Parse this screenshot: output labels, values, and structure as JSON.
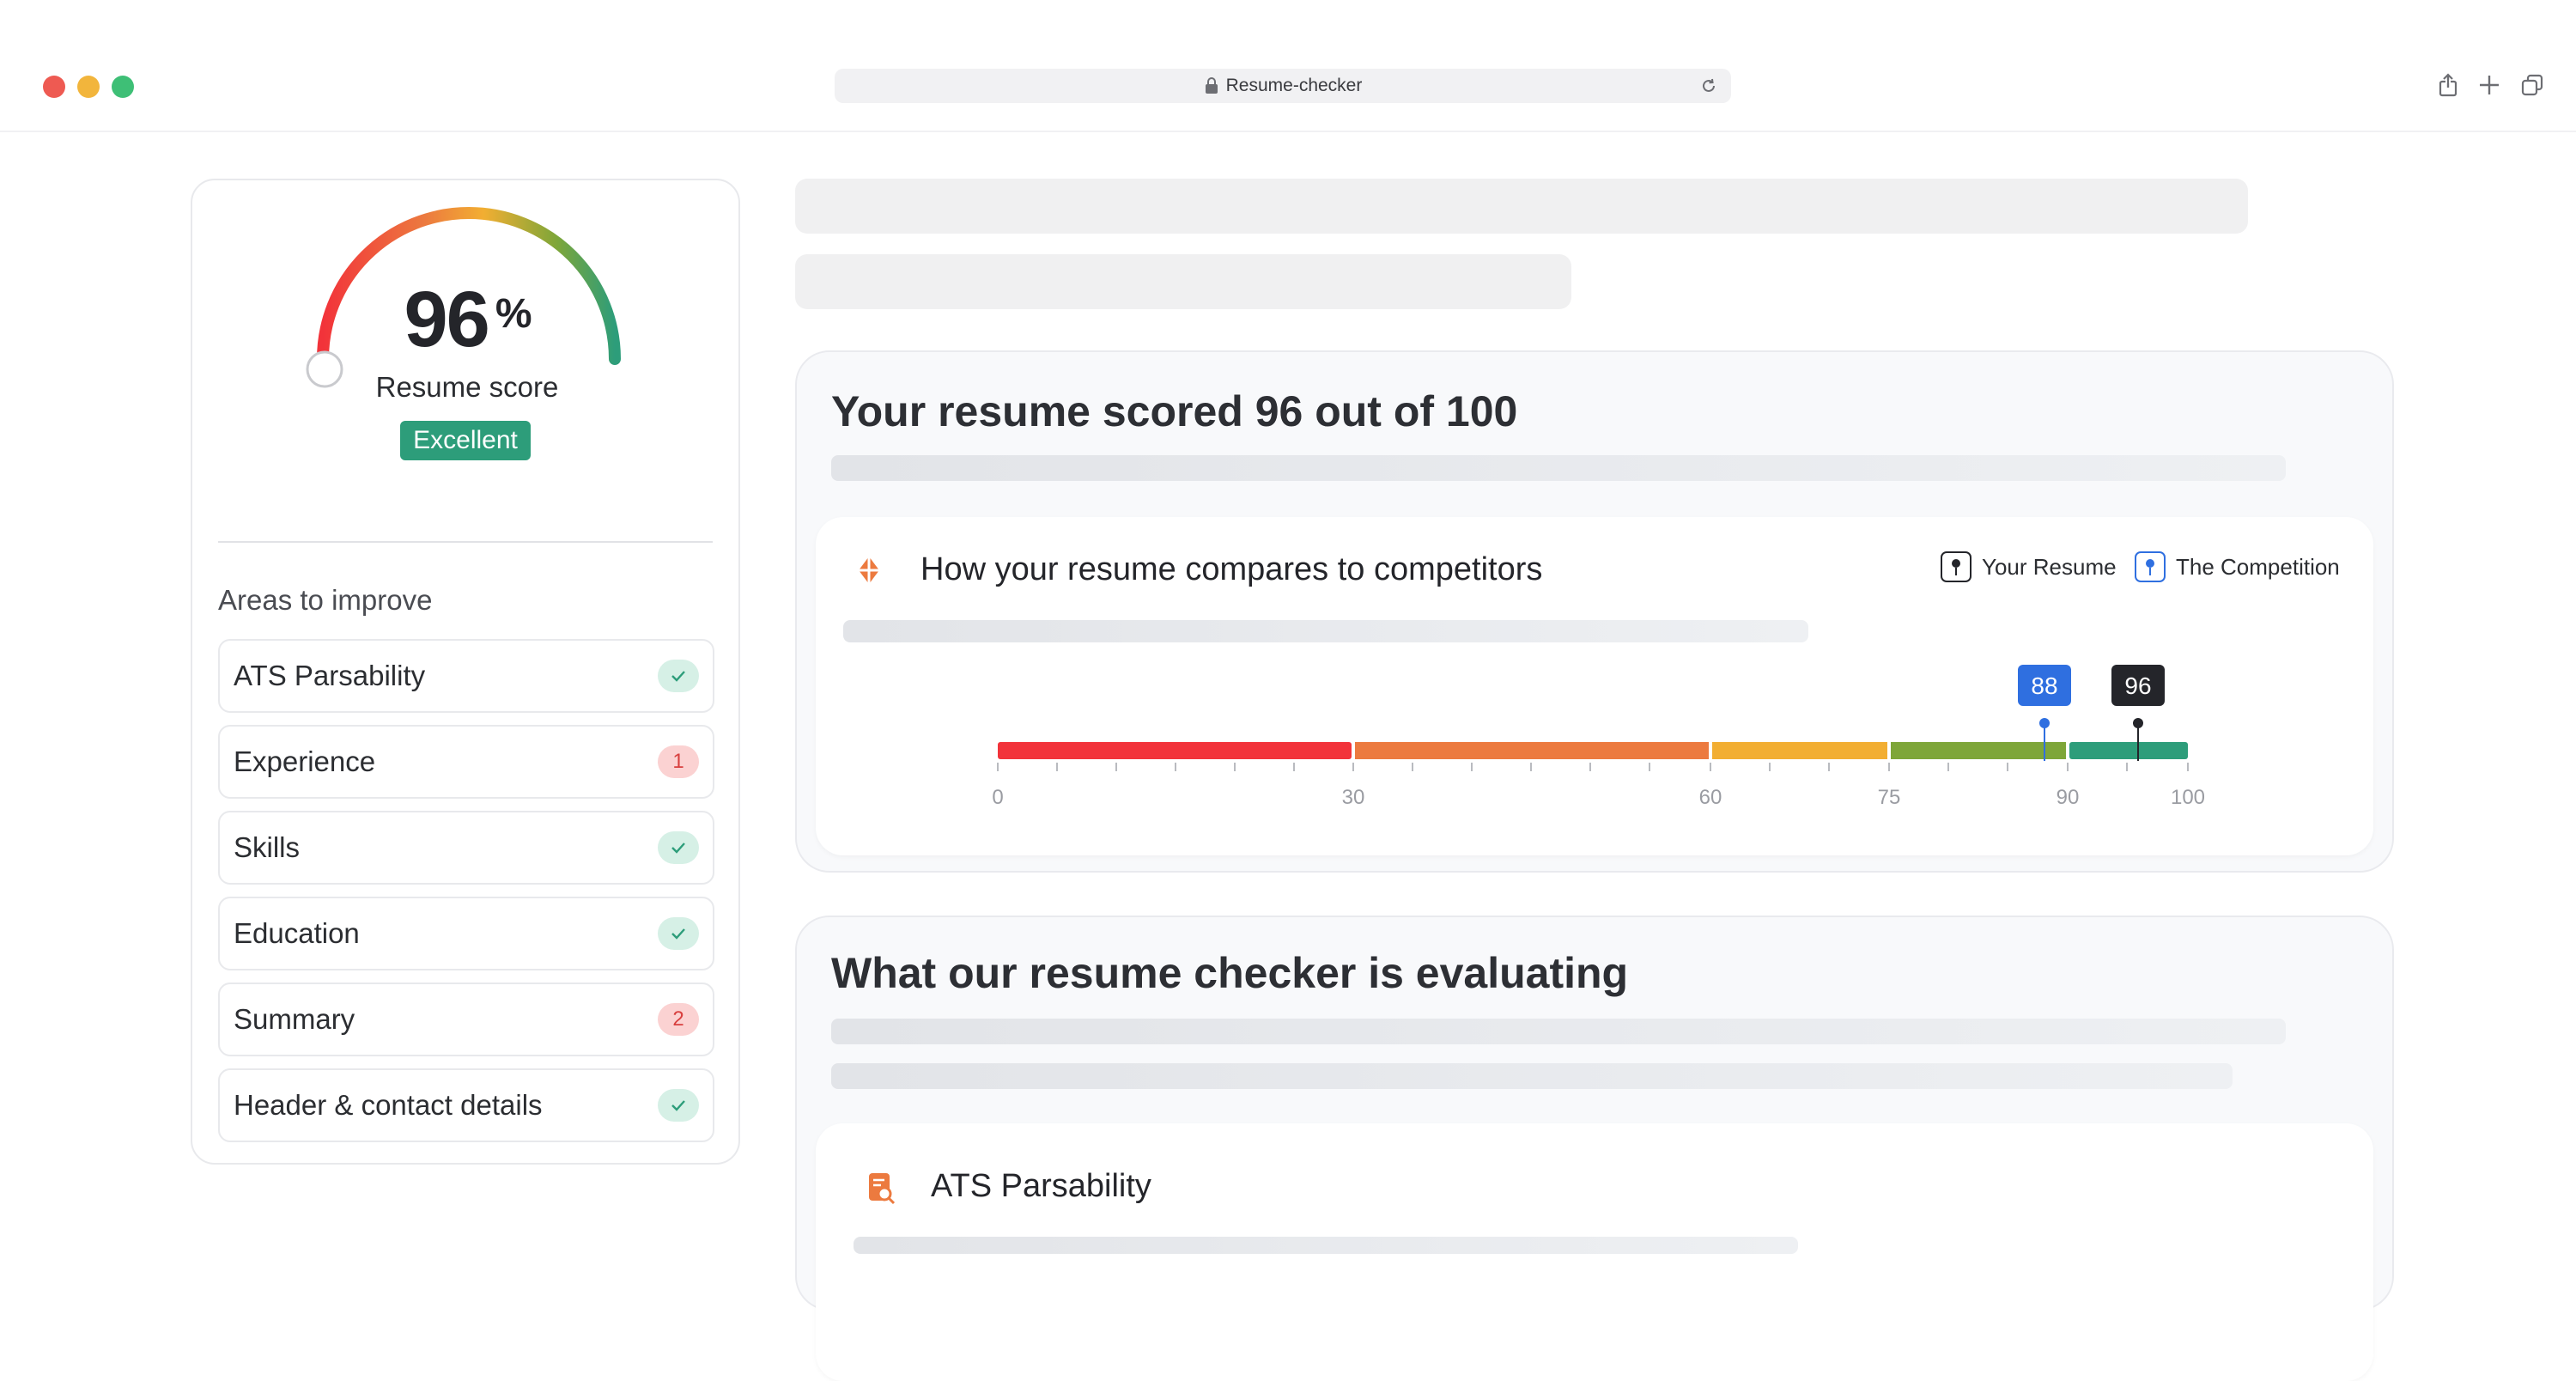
{
  "browser": {
    "url": "Resume-checker"
  },
  "score_panel": {
    "score": "96",
    "percent_sign": "%",
    "label": "Resume score",
    "badge": "Excellent",
    "gauge_value_percent": 96,
    "areas_title": "Areas to improve",
    "areas": [
      {
        "label": "ATS Parsability",
        "status": "check"
      },
      {
        "label": "Experience",
        "status": "count",
        "count": "1"
      },
      {
        "label": "Skills",
        "status": "check"
      },
      {
        "label": "Education",
        "status": "check"
      },
      {
        "label": "Summary",
        "status": "count",
        "count": "2"
      },
      {
        "label": "Header & contact details",
        "status": "check"
      }
    ]
  },
  "score_section": {
    "title": "Your resume scored 96 out of 100",
    "compare_title": "How your resume compares to competitors",
    "legend": {
      "your_resume": "Your Resume",
      "competition": "The Competition"
    },
    "markers": {
      "competition": "88",
      "your_resume": "96"
    },
    "ticks": [
      "0",
      "30",
      "60",
      "75",
      "90",
      "100"
    ]
  },
  "eval_section": {
    "title": "What our resume checker is evaluating",
    "ats_title": "ATS Parsability"
  },
  "colors": {
    "red": "#f2333a",
    "orange": "#ec7a3f",
    "yellow": "#f2ae32",
    "olive": "#7ea639",
    "teal": "#2d9d7a",
    "blue": "#2f6fe0",
    "dark": "#24252a"
  }
}
